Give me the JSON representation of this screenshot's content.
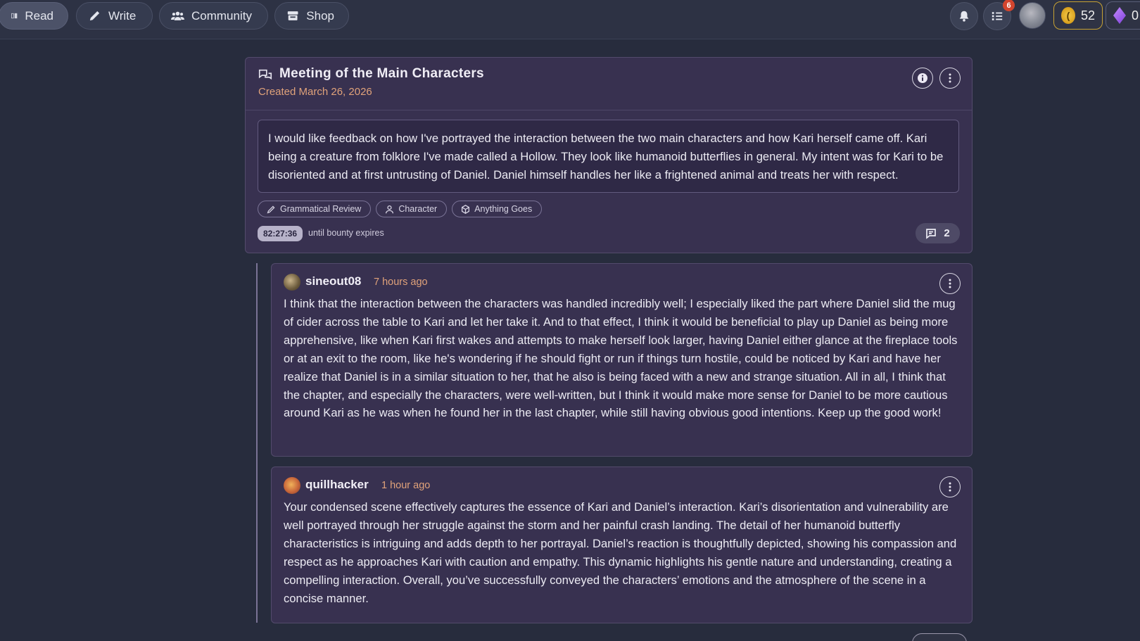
{
  "nav": {
    "items": [
      {
        "label": "Read",
        "icon": "book-icon"
      },
      {
        "label": "Write",
        "icon": "pencil-icon"
      },
      {
        "label": "Community",
        "icon": "users-icon"
      },
      {
        "label": "Shop",
        "icon": "store-icon"
      }
    ],
    "active": "Read",
    "task_badge": "6",
    "coins": "52",
    "gems": "0"
  },
  "thread": {
    "title": "Meeting of the Main Characters",
    "created": "Created March 26, 2026",
    "description": "I would like feedback on how I've portrayed the interaction between the two main characters and how Kari herself came off. Kari being a creature from folklore I've made called a Hollow. They look like humanoid butterflies in general. My intent was for Kari to be disoriented and at first untrusting of Daniel. Daniel himself handles her like a frightened animal and treats her with respect.",
    "tags": [
      "Grammatical Review",
      "Character",
      "Anything Goes"
    ],
    "timer": "82:27:36",
    "timer_label": "until bounty expires",
    "comment_count": "2"
  },
  "comments": [
    {
      "author": "sineout08",
      "time": "7 hours ago",
      "body": "I think that the interaction between the characters was handled incredibly well; I especially liked the part where Daniel slid the mug of cider across the table to Kari and let her take it. And to that effect, I think it would be beneficial to play up Daniel as being more apprehensive, like when Kari first wakes and attempts to make herself look larger, having Daniel either glance at the fireplace tools or at an exit to the room, like he's wondering if he should fight or run if things turn hostile, could be noticed by Kari and have her realize that Daniel is in a similar situation to her, that he also is being faced with a new and strange situation. All in all, I think that the chapter, and especially the characters, were well-written, but I think it would make more sense for Daniel to be more cautious around Kari as he was when he found her in the last chapter, while still having obvious good intentions. Keep up the good work!"
    },
    {
      "author": "quillhacker",
      "time": "1 hour ago",
      "body": "Your condensed scene effectively captures the essence of Kari and Daniel’s interaction. Kari’s disorientation and vulnerability are well portrayed through her struggle against the storm and her painful crash landing. The detail of her humanoid butterfly characteristics is intriguing and adds depth to her portrayal. Daniel’s reaction is thoughtfully depicted, showing his compassion and respect as he approaches Kari with caution and empathy. This dynamic highlights his gentle nature and understanding, creating a compelling interaction. Overall, you’ve successfully conveyed the characters’ emotions and the atmosphere of the scene in a concise manner."
    }
  ],
  "colors": {
    "background": "#272c3d",
    "card": "#383150",
    "accent_time": "#e0a27a",
    "badge": "#d2452e",
    "coin": "#d9a11e"
  }
}
